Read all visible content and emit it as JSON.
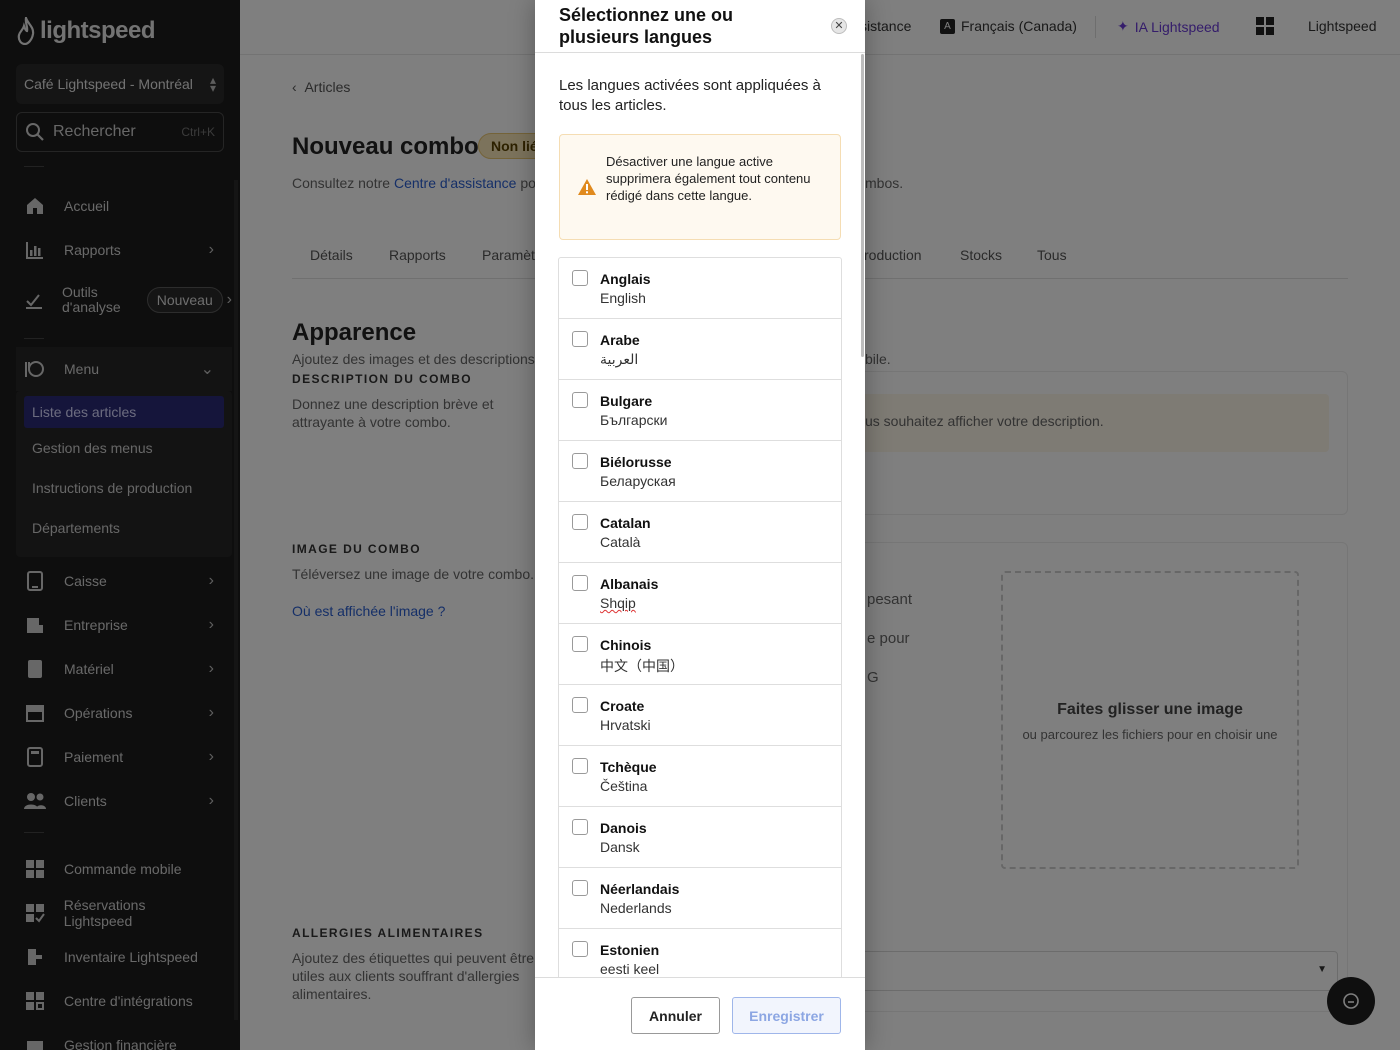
{
  "sidebar": {
    "logo_text": "lightspeed",
    "location": "Café Lightspeed - Montréal",
    "search_label": "Rechercher",
    "search_shortcut": "Ctrl+K",
    "nav": {
      "accueil": "Accueil",
      "rapports": "Rapports",
      "outils": "Outils d'analyse",
      "outils_badge": "Nouveau",
      "menu": "Menu",
      "caisse": "Caisse",
      "entreprise": "Entreprise",
      "materiel": "Matériel",
      "operations": "Opérations",
      "paiement": "Paiement",
      "clients": "Clients",
      "commande_mobile": "Commande mobile",
      "reservations": "Réservations Lightspeed",
      "inventaire": "Inventaire Lightspeed",
      "integrations": "Centre d'intégrations",
      "gestion_financiere": "Gestion financière"
    },
    "menu_sub": {
      "liste_articles": "Liste des articles",
      "gestion_menus": "Gestion des menus",
      "instructions": "Instructions de production",
      "departements": "Départements"
    }
  },
  "topbar": {
    "assistance": "sistance",
    "language": "Français (Canada)",
    "ai": "IA Lightspeed",
    "account": "Lightspeed"
  },
  "page": {
    "breadcrumb": "Articles",
    "title": "Nouveau combo",
    "status": "Non lié",
    "help_prefix": "Consultez notre",
    "help_link": "Centre d'assistance",
    "help_suffix": "pou",
    "help_tail": "mbos.",
    "tabs": {
      "details": "Détails",
      "rapports": "Rapports",
      "parametres": "Paramèt",
      "production": "roduction",
      "stocks": "Stocks",
      "tous": "Tous"
    },
    "appearance_title": "Apparence",
    "appearance_sub": "Ajoutez des images et des descriptions p",
    "appearance_tail": "bile.",
    "description_label": "DESCRIPTION DU COMBO",
    "description_help": "Donnez une description brève et attrayante à votre combo.",
    "description_right": "us souhaitez afficher votre description.",
    "image_label": "IMAGE DU COMBO",
    "image_help": "Téléversez une image de votre combo.",
    "image_link": "Où est affichée l'image ?",
    "upload_line_1": "pesant",
    "upload_line_2": "e pour",
    "upload_line_3": "G",
    "dropzone_title": "Faites glisser une image",
    "dropzone_sub": "ou parcourez les fichiers pour en choisir une",
    "allergy_label": "ALLERGIES ALIMENTAIRES",
    "allergy_help": "Ajoutez des étiquettes qui peuvent être utiles aux clients souffrant d'allergies alimentaires."
  },
  "modal": {
    "title": "Sélectionnez une ou plusieurs langues",
    "intro": "Les langues activées sont appliquées à tous les articles.",
    "warning": "Désactiver une langue active supprimera également tout contenu rédigé dans cette langue.",
    "languages": [
      {
        "name": "Anglais",
        "native": "English"
      },
      {
        "name": "Arabe",
        "native": "العربية"
      },
      {
        "name": "Bulgare",
        "native": "Български"
      },
      {
        "name": "Biélorusse",
        "native": "Беларуская"
      },
      {
        "name": "Catalan",
        "native": "Català"
      },
      {
        "name": "Albanais",
        "native": "Shqip"
      },
      {
        "name": "Chinois",
        "native": "中文（中国）"
      },
      {
        "name": "Croate",
        "native": "Hrvatski"
      },
      {
        "name": "Tchèque",
        "native": "Čeština"
      },
      {
        "name": "Danois",
        "native": "Dansk"
      },
      {
        "name": "Néerlandais",
        "native": "Nederlands"
      },
      {
        "name": "Estonien",
        "native": "eesti keel"
      }
    ],
    "cancel_label": "Annuler",
    "save_label": "Enregistrer"
  },
  "colors": {
    "sidebar_bg": "#1c1c1c",
    "active_nav": "#2a2a77",
    "ai_purple": "#6a3bd6",
    "link_blue": "#2b5fd0",
    "warning_orange": "#e08a1e"
  }
}
